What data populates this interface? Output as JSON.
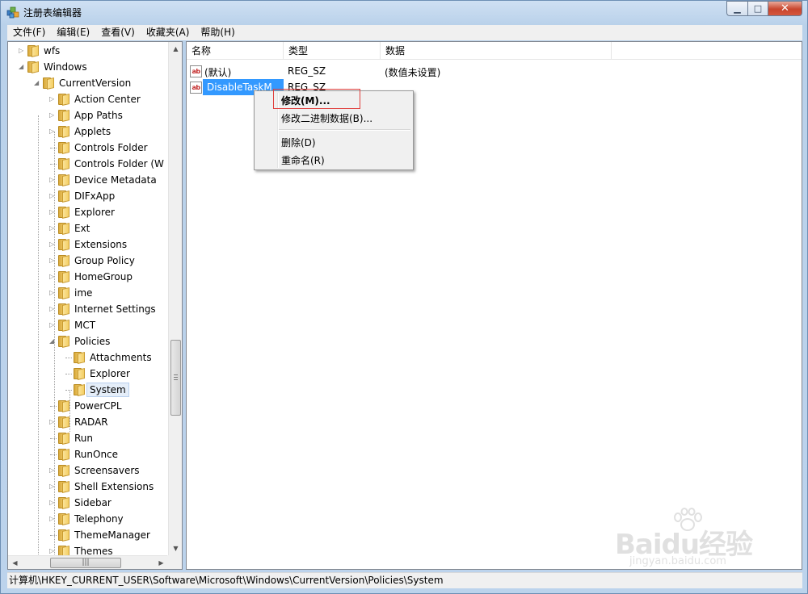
{
  "window": {
    "title": "注册表编辑器"
  },
  "menu": [
    "文件(F)",
    "编辑(E)",
    "查看(V)",
    "收藏夹(A)",
    "帮助(H)"
  ],
  "tree": [
    {
      "label": "wfs",
      "level": 1,
      "arrow": "collapsed"
    },
    {
      "label": "Windows",
      "level": 1,
      "arrow": "expanded"
    },
    {
      "label": "CurrentVersion",
      "level": 2,
      "arrow": "expanded"
    },
    {
      "label": "Action Center",
      "level": 3,
      "arrow": "collapsed"
    },
    {
      "label": "App Paths",
      "level": 3,
      "arrow": "collapsed"
    },
    {
      "label": "Applets",
      "level": 3,
      "arrow": "collapsed"
    },
    {
      "label": "Controls Folder",
      "level": 3,
      "arrow": "none"
    },
    {
      "label": "Controls Folder (W",
      "level": 3,
      "arrow": "none"
    },
    {
      "label": "Device Metadata",
      "level": 3,
      "arrow": "collapsed"
    },
    {
      "label": "DIFxApp",
      "level": 3,
      "arrow": "collapsed"
    },
    {
      "label": "Explorer",
      "level": 3,
      "arrow": "collapsed"
    },
    {
      "label": "Ext",
      "level": 3,
      "arrow": "collapsed"
    },
    {
      "label": "Extensions",
      "level": 3,
      "arrow": "collapsed"
    },
    {
      "label": "Group Policy",
      "level": 3,
      "arrow": "collapsed"
    },
    {
      "label": "HomeGroup",
      "level": 3,
      "arrow": "collapsed"
    },
    {
      "label": "ime",
      "level": 3,
      "arrow": "collapsed"
    },
    {
      "label": "Internet Settings",
      "level": 3,
      "arrow": "collapsed"
    },
    {
      "label": "MCT",
      "level": 3,
      "arrow": "collapsed"
    },
    {
      "label": "Policies",
      "level": 3,
      "arrow": "expanded"
    },
    {
      "label": "Attachments",
      "level": 4,
      "arrow": "none"
    },
    {
      "label": "Explorer",
      "level": 4,
      "arrow": "none"
    },
    {
      "label": "System",
      "level": 4,
      "arrow": "none",
      "selected": true
    },
    {
      "label": "PowerCPL",
      "level": 3,
      "arrow": "none"
    },
    {
      "label": "RADAR",
      "level": 3,
      "arrow": "collapsed"
    },
    {
      "label": "Run",
      "level": 3,
      "arrow": "none"
    },
    {
      "label": "RunOnce",
      "level": 3,
      "arrow": "none"
    },
    {
      "label": "Screensavers",
      "level": 3,
      "arrow": "collapsed"
    },
    {
      "label": "Shell Extensions",
      "level": 3,
      "arrow": "collapsed"
    },
    {
      "label": "Sidebar",
      "level": 3,
      "arrow": "collapsed"
    },
    {
      "label": "Telephony",
      "level": 3,
      "arrow": "collapsed"
    },
    {
      "label": "ThemeManager",
      "level": 3,
      "arrow": "none"
    },
    {
      "label": "Themes",
      "level": 3,
      "arrow": "collapsed"
    }
  ],
  "list": {
    "columns": [
      "名称",
      "类型",
      "数据"
    ],
    "rows": [
      {
        "name": "(默认)",
        "type": "REG_SZ",
        "data": "(数值未设置)"
      },
      {
        "name": "DisableTaskM",
        "type": "REG_SZ",
        "data": "",
        "selected": true
      }
    ]
  },
  "context_menu": {
    "items": [
      {
        "label": "修改(M)...",
        "bold": true
      },
      {
        "label": "修改二进制数据(B)..."
      },
      {
        "separator": true
      },
      {
        "label": "删除(D)"
      },
      {
        "label": "重命名(R)"
      }
    ]
  },
  "status": "计算机\\HKEY_CURRENT_USER\\Software\\Microsoft\\Windows\\CurrentVersion\\Policies\\System",
  "watermark": {
    "logo": "Baidu经验",
    "sub": "jingyan.baidu.com"
  },
  "colors": {
    "selection": "#3399ff",
    "highlight_box": "#e0403e",
    "folder": "#f3d27a"
  }
}
